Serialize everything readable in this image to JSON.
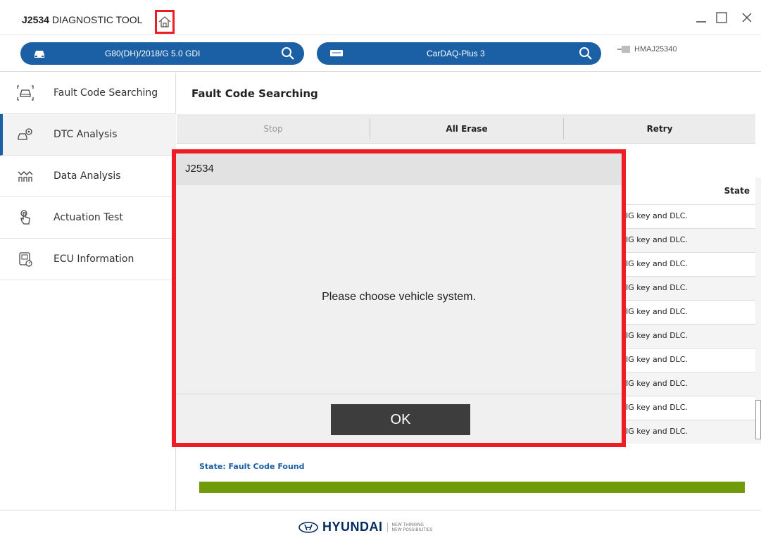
{
  "app": {
    "title_bold": "J2534",
    "title_rest": " DIAGNOSTIC TOOL"
  },
  "selectors": {
    "vehicle": "G80(DH)/2018/G 5.0 GDI",
    "device": "CarDAQ-Plus 3",
    "device_id": "HMAJ25340"
  },
  "sidebar": {
    "items": [
      {
        "label": "Fault Code Searching",
        "icon": "car-search-icon"
      },
      {
        "label": "DTC Analysis",
        "icon": "car-gear-icon"
      },
      {
        "label": "Data Analysis",
        "icon": "waveform-icon"
      },
      {
        "label": "Actuation Test",
        "icon": "hand-pointer-icon"
      },
      {
        "label": "ECU Information",
        "icon": "ecu-chip-icon"
      }
    ]
  },
  "main": {
    "page_title": "Fault Code Searching",
    "actions": {
      "stop": "Stop",
      "all_erase": "All Erase",
      "retry": "Retry"
    },
    "table": {
      "state_header": "State",
      "rows": [
        "IG key and DLC.",
        "IG key and DLC.",
        "IG key and DLC.",
        "IG key and DLC.",
        "IG key and DLC.",
        "IG key and DLC.",
        "IG key and DLC.",
        "IG key and DLC.",
        "IG key and DLC.",
        "IG key and DLC."
      ]
    },
    "state_text": "State: Fault Code Found",
    "progress": 1.0
  },
  "footer": {
    "brand": "HYUNDAI",
    "tagline_1": "NEW THINKING",
    "tagline_2": "NEW POSSIBILITIES"
  },
  "modal": {
    "title": "J2534",
    "message": "Please choose vehicle system.",
    "ok_label": "OK"
  },
  "colors": {
    "accent": "#1b5fa4",
    "progress": "#6f9a0a",
    "highlight": "#ee1c24"
  }
}
